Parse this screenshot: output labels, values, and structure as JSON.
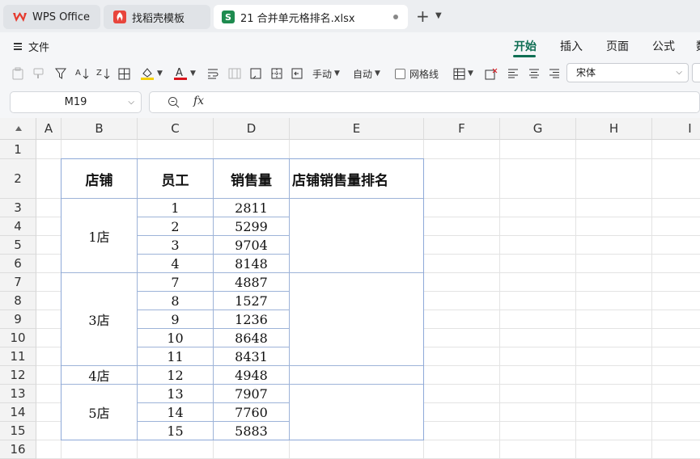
{
  "tabs": [
    {
      "label": "WPS Office"
    },
    {
      "label": "找稻壳模板"
    },
    {
      "label": "21 合并单元格排名.xlsx",
      "icon_letter": "S"
    }
  ],
  "menu": {
    "file_label": "文件",
    "ribbon_tabs": [
      "开始",
      "插入",
      "页面",
      "公式"
    ],
    "active_tab": "开始"
  },
  "toolbar": {
    "manual_label": "手动",
    "auto_label": "自动",
    "gridlines_label": "网格线",
    "gridlines_checked": false,
    "font_name": "宋体"
  },
  "formula_bar": {
    "cell_ref": "M19",
    "fx_symbol": "fx",
    "content": ""
  },
  "grid": {
    "columns": [
      "A",
      "B",
      "C",
      "D",
      "E",
      "F",
      "G",
      "H",
      "I"
    ],
    "rows": [
      "1",
      "2",
      "3",
      "4",
      "5",
      "6",
      "7",
      "8",
      "9",
      "10",
      "11",
      "12",
      "13",
      "14",
      "15",
      "16"
    ]
  },
  "table": {
    "headers": [
      "店铺",
      "员工",
      "销售量",
      "店铺销售量排名"
    ],
    "stores": [
      {
        "name": "1店",
        "rows": [
          [
            "1",
            "2811"
          ],
          [
            "2",
            "5299"
          ],
          [
            "3",
            "9704"
          ],
          [
            "4",
            "8148"
          ]
        ]
      },
      {
        "name": "3店",
        "rows": [
          [
            "7",
            "4887"
          ],
          [
            "8",
            "1527"
          ],
          [
            "9",
            "1236"
          ],
          [
            "10",
            "8648"
          ],
          [
            "11",
            "8431"
          ]
        ]
      },
      {
        "name": "4店",
        "rows": [
          [
            "12",
            "4948"
          ]
        ]
      },
      {
        "name": "5店",
        "rows": [
          [
            "13",
            "7907"
          ],
          [
            "14",
            "7760"
          ],
          [
            "15",
            "5883"
          ]
        ]
      }
    ]
  },
  "colors": {
    "accent": "#0f6e53",
    "table_border": "#8ea9d8",
    "wps_red": "#e63a2e",
    "sheet_green": "#1e8b4f"
  }
}
